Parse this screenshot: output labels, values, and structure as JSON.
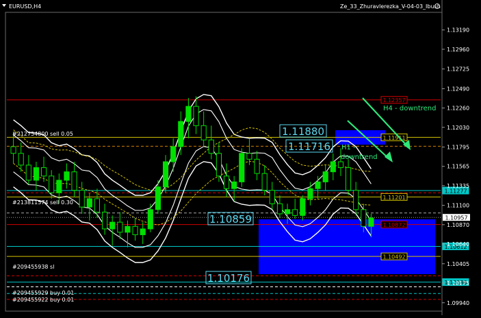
{
  "window": {
    "symbol_title": "EURUSD,H4",
    "indicator_title": "Ze_33_Zhuravlerezka_V-04-03_Ibush"
  },
  "chart_data": {
    "type": "candlestick",
    "symbol": "EURUSD",
    "timeframe": "H4",
    "ylim": [
      1.0984,
      1.134
    ],
    "grid": false,
    "current_price": 1.10957,
    "y_ticks": [
      1.1319,
      1.1296,
      1.12725,
      1.1249,
      1.1226,
      1.1203,
      1.11795,
      1.11565,
      1.11335,
      1.111,
      1.1087,
      1.1064,
      1.10405,
      1.10175,
      1.0994
    ],
    "candles": [
      [
        1.118,
        1.1198,
        1.116,
        1.1172
      ],
      [
        1.1172,
        1.1185,
        1.115,
        1.1158
      ],
      [
        1.1158,
        1.117,
        1.1135,
        1.114
      ],
      [
        1.114,
        1.1162,
        1.1128,
        1.1155
      ],
      [
        1.1155,
        1.1168,
        1.1138,
        1.1145
      ],
      [
        1.1145,
        1.1152,
        1.1118,
        1.1125
      ],
      [
        1.1125,
        1.1148,
        1.1112,
        1.114
      ],
      [
        1.114,
        1.116,
        1.113,
        1.115
      ],
      [
        1.115,
        1.1162,
        1.112,
        1.1128
      ],
      [
        1.1128,
        1.1138,
        1.11,
        1.1108
      ],
      [
        1.1108,
        1.1125,
        1.1092,
        1.1118
      ],
      [
        1.1118,
        1.113,
        1.1095,
        1.1102
      ],
      [
        1.1102,
        1.1112,
        1.1075,
        1.1082
      ],
      [
        1.1082,
        1.1098,
        1.1062,
        1.109
      ],
      [
        1.109,
        1.1102,
        1.107,
        1.1078
      ],
      [
        1.1078,
        1.1092,
        1.106,
        1.1085
      ],
      [
        1.1085,
        1.1095,
        1.1068,
        1.1075
      ],
      [
        1.1075,
        1.109,
        1.1064,
        1.1082
      ],
      [
        1.1082,
        1.1112,
        1.1078,
        1.1105
      ],
      [
        1.1105,
        1.114,
        1.11,
        1.1132
      ],
      [
        1.1132,
        1.117,
        1.1125,
        1.1162
      ],
      [
        1.1162,
        1.119,
        1.115,
        1.118
      ],
      [
        1.118,
        1.1222,
        1.117,
        1.121
      ],
      [
        1.121,
        1.1238,
        1.119,
        1.1228
      ],
      [
        1.1228,
        1.124,
        1.1195,
        1.1205
      ],
      [
        1.1205,
        1.1222,
        1.118,
        1.1188
      ],
      [
        1.1188,
        1.1205,
        1.1165,
        1.1172
      ],
      [
        1.1172,
        1.1185,
        1.1138,
        1.1145
      ],
      [
        1.1145,
        1.116,
        1.112,
        1.113
      ],
      [
        1.113,
        1.1145,
        1.1115,
        1.1138
      ],
      [
        1.1138,
        1.1178,
        1.1132,
        1.1172
      ],
      [
        1.1172,
        1.119,
        1.1158,
        1.1165
      ],
      [
        1.1165,
        1.1175,
        1.114,
        1.1148
      ],
      [
        1.1148,
        1.1158,
        1.1122,
        1.1128
      ],
      [
        1.1128,
        1.1138,
        1.1105,
        1.1112
      ],
      [
        1.1112,
        1.1122,
        1.1095,
        1.11
      ],
      [
        1.11,
        1.1112,
        1.1088,
        1.1105
      ],
      [
        1.1105,
        1.1118,
        1.1094,
        1.1098
      ],
      [
        1.1098,
        1.1122,
        1.1092,
        1.1118
      ],
      [
        1.1118,
        1.1138,
        1.111,
        1.113
      ],
      [
        1.113,
        1.1145,
        1.1118,
        1.1138
      ],
      [
        1.1138,
        1.1158,
        1.1128,
        1.115
      ],
      [
        1.115,
        1.1172,
        1.114,
        1.1162
      ],
      [
        1.1162,
        1.1178,
        1.1145,
        1.1155
      ],
      [
        1.1155,
        1.1165,
        1.1122,
        1.1128
      ],
      [
        1.1128,
        1.1138,
        1.1098,
        1.1105
      ],
      [
        1.1105,
        1.1112,
        1.1078,
        1.1085
      ],
      [
        1.1085,
        1.11,
        1.1072,
        1.1095
      ]
    ],
    "horizontal_levels": [
      {
        "value": 1.12357,
        "color": "#d40000",
        "label": "1.12357"
      },
      {
        "value": 1.11911,
        "color": "#d4c400",
        "label": "1.11911"
      },
      {
        "value": 1.11277,
        "color": "#00c8c8",
        "label": "1.11277"
      },
      {
        "value": 1.11201,
        "color": "#d4c400",
        "label": "1.11201"
      },
      {
        "value": 1.10872,
        "color": "#d40000",
        "label": "1.10872"
      },
      {
        "value": 1.10612,
        "color": "#00c8c8",
        "label": "1.10612"
      },
      {
        "value": 1.10492,
        "color": "#d4c400",
        "label": "1.10492"
      },
      {
        "value": 1.10186,
        "color": "#00c8c8",
        "label": "1.10186"
      }
    ],
    "big_labels": [
      "1.11880",
      "1.11716",
      "1.10859",
      "1.10176"
    ],
    "annotations": {
      "h4_trend": "H4 - downtrend",
      "h1_trend": "H1 -\ndowntrend"
    },
    "order_labels": [
      "#212754800 sell 0.05",
      "#213811574 sell 0.30",
      "#209455938 sl",
      "#209455929 buy 0.01",
      "#209455922 buy 0.01"
    ],
    "colors": {
      "bull": "#00e000",
      "bear": "#00e000",
      "band": "#ffffff",
      "ma_dotted": "#d4c400",
      "zone": "#0000ff"
    }
  }
}
